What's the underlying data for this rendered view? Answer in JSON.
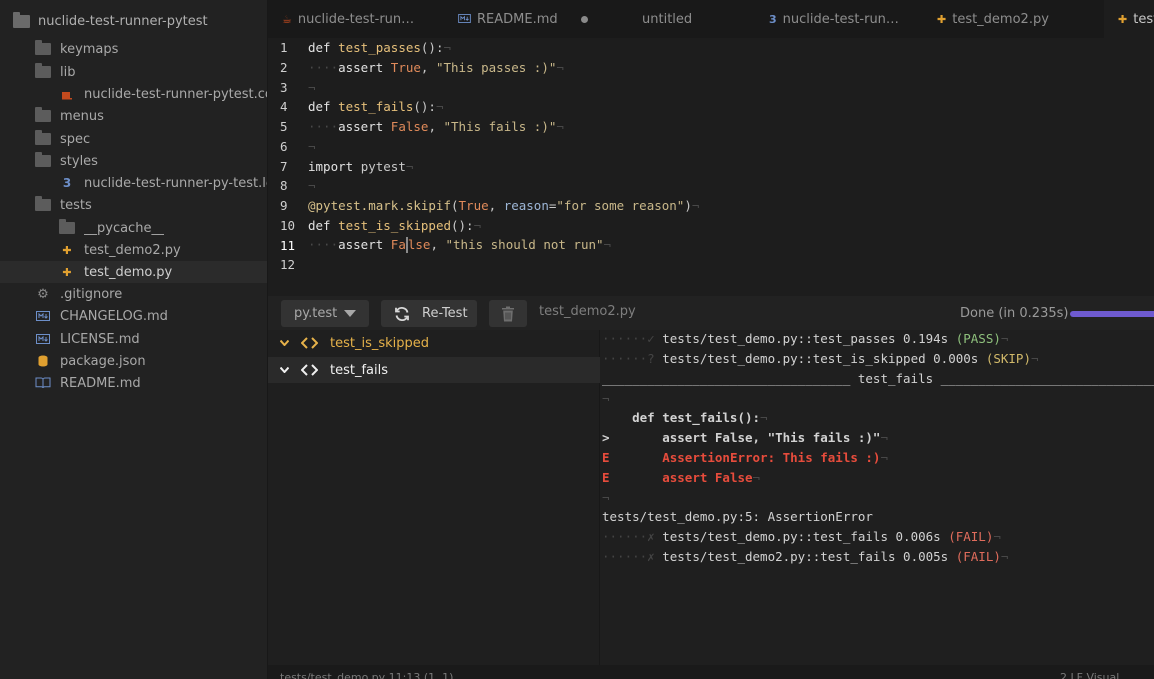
{
  "tree": {
    "root": "nuclide-test-runner-pytest",
    "items": [
      {
        "label": "keymaps"
      },
      {
        "label": "lib"
      },
      {
        "label": "nuclide-test-runner-pytest.coffee"
      },
      {
        "label": "menus"
      },
      {
        "label": "spec"
      },
      {
        "label": "styles"
      },
      {
        "label": "nuclide-test-runner-py-test.less"
      },
      {
        "label": "tests"
      },
      {
        "label": "__pycache__"
      },
      {
        "label": "test_demo2.py"
      },
      {
        "label": "test_demo.py"
      },
      {
        "label": ".gitignore"
      },
      {
        "label": "CHANGELOG.md"
      },
      {
        "label": "LICENSE.md"
      },
      {
        "label": "package.json"
      },
      {
        "label": "README.md"
      }
    ]
  },
  "tabs": [
    {
      "label": "nuclide-test-run…"
    },
    {
      "label": "README.md"
    },
    {
      "label": "untitled"
    },
    {
      "label": "nuclide-test-run…"
    },
    {
      "label": "test_demo2.py"
    },
    {
      "label": "test"
    }
  ],
  "editor": {
    "line_numbers": [
      "1",
      "2",
      "3",
      "4",
      "5",
      "6",
      "7",
      "8",
      "9",
      "10",
      "11",
      "12"
    ],
    "line1": {
      "kw": "def",
      "fn": "test_passes",
      "rest": "():"
    },
    "line2": {
      "indent": "····",
      "kw": "assert",
      "bool": "True",
      "sep": ", ",
      "str": "\"This passes :)\""
    },
    "line4": {
      "kw": "def",
      "fn": "test_fails",
      "rest": "():"
    },
    "line5": {
      "indent": "····",
      "kw": "assert",
      "bool": "False",
      "sep": ", ",
      "str": "\"This fails :)\""
    },
    "line7": {
      "kw": "import",
      "mod": "pytest"
    },
    "line9": {
      "dec": "@pytest.mark.skipif",
      "open": "(",
      "bool": "True",
      "sep": ", ",
      "param": "reason",
      "eq": "=",
      "str": "\"for some reason\"",
      "close": ")"
    },
    "line10": {
      "kw": "def",
      "fn": "test_is_skipped",
      "rest": "():"
    },
    "line11": {
      "indent": "····",
      "kw": "assert",
      "bool_a": "Fa",
      "bool_b": "lse",
      "sep": ", ",
      "str": "\"this should not run\""
    },
    "eol": "¬"
  },
  "panel": {
    "runner": "py.test",
    "retest": "Re-Test",
    "file": "test_demo2.py",
    "status": "Done (in 0.235s)",
    "progress": 1.0,
    "tests": [
      {
        "name": "test_is_skipped"
      },
      {
        "name": "test_fails"
      }
    ],
    "output": {
      "l1": {
        "prefix": "······✓ ",
        "text": "tests/test_demo.py::test_passes 0.194s ",
        "status": "(PASS)"
      },
      "l2": {
        "prefix": "······? ",
        "text": "tests/test_demo.py::test_is_skipped 0.000s ",
        "status": "(SKIP)"
      },
      "l3": {
        "text": "_________________________________ test_fails __________________________________"
      },
      "l5": {
        "text": "    def test_fails():"
      },
      "l6": {
        "marker": ">",
        "text": "       assert False, \"This fails :)\""
      },
      "l7": {
        "marker": "E",
        "text": "       AssertionError: This fails :)"
      },
      "l8": {
        "marker": "E",
        "text": "       assert False"
      },
      "l10": {
        "text": "tests/test_demo.py:5: AssertionError"
      },
      "l11": {
        "prefix": "······✗ ",
        "text": "tests/test_demo.py::test_fails 0.006s ",
        "status": "(FAIL)"
      },
      "l12": {
        "prefix": "······✗ ",
        "text": "tests/test_demo2.py::test_fails 0.005s ",
        "status": "(FAIL)"
      }
    }
  },
  "statusbar": {
    "path": "tests/test_demo.py 11:13 (1, 1)",
    "right": "2 LF Visual"
  },
  "colors": {
    "accent_progress": "#6e5ad0",
    "pass": "#8ec07c",
    "skip": "#d1b96a",
    "fail": "#e06c5c",
    "python_icon": "#e0a030",
    "coffee_icon": "#c24a1e",
    "css_icon": "#6d8fc9"
  }
}
